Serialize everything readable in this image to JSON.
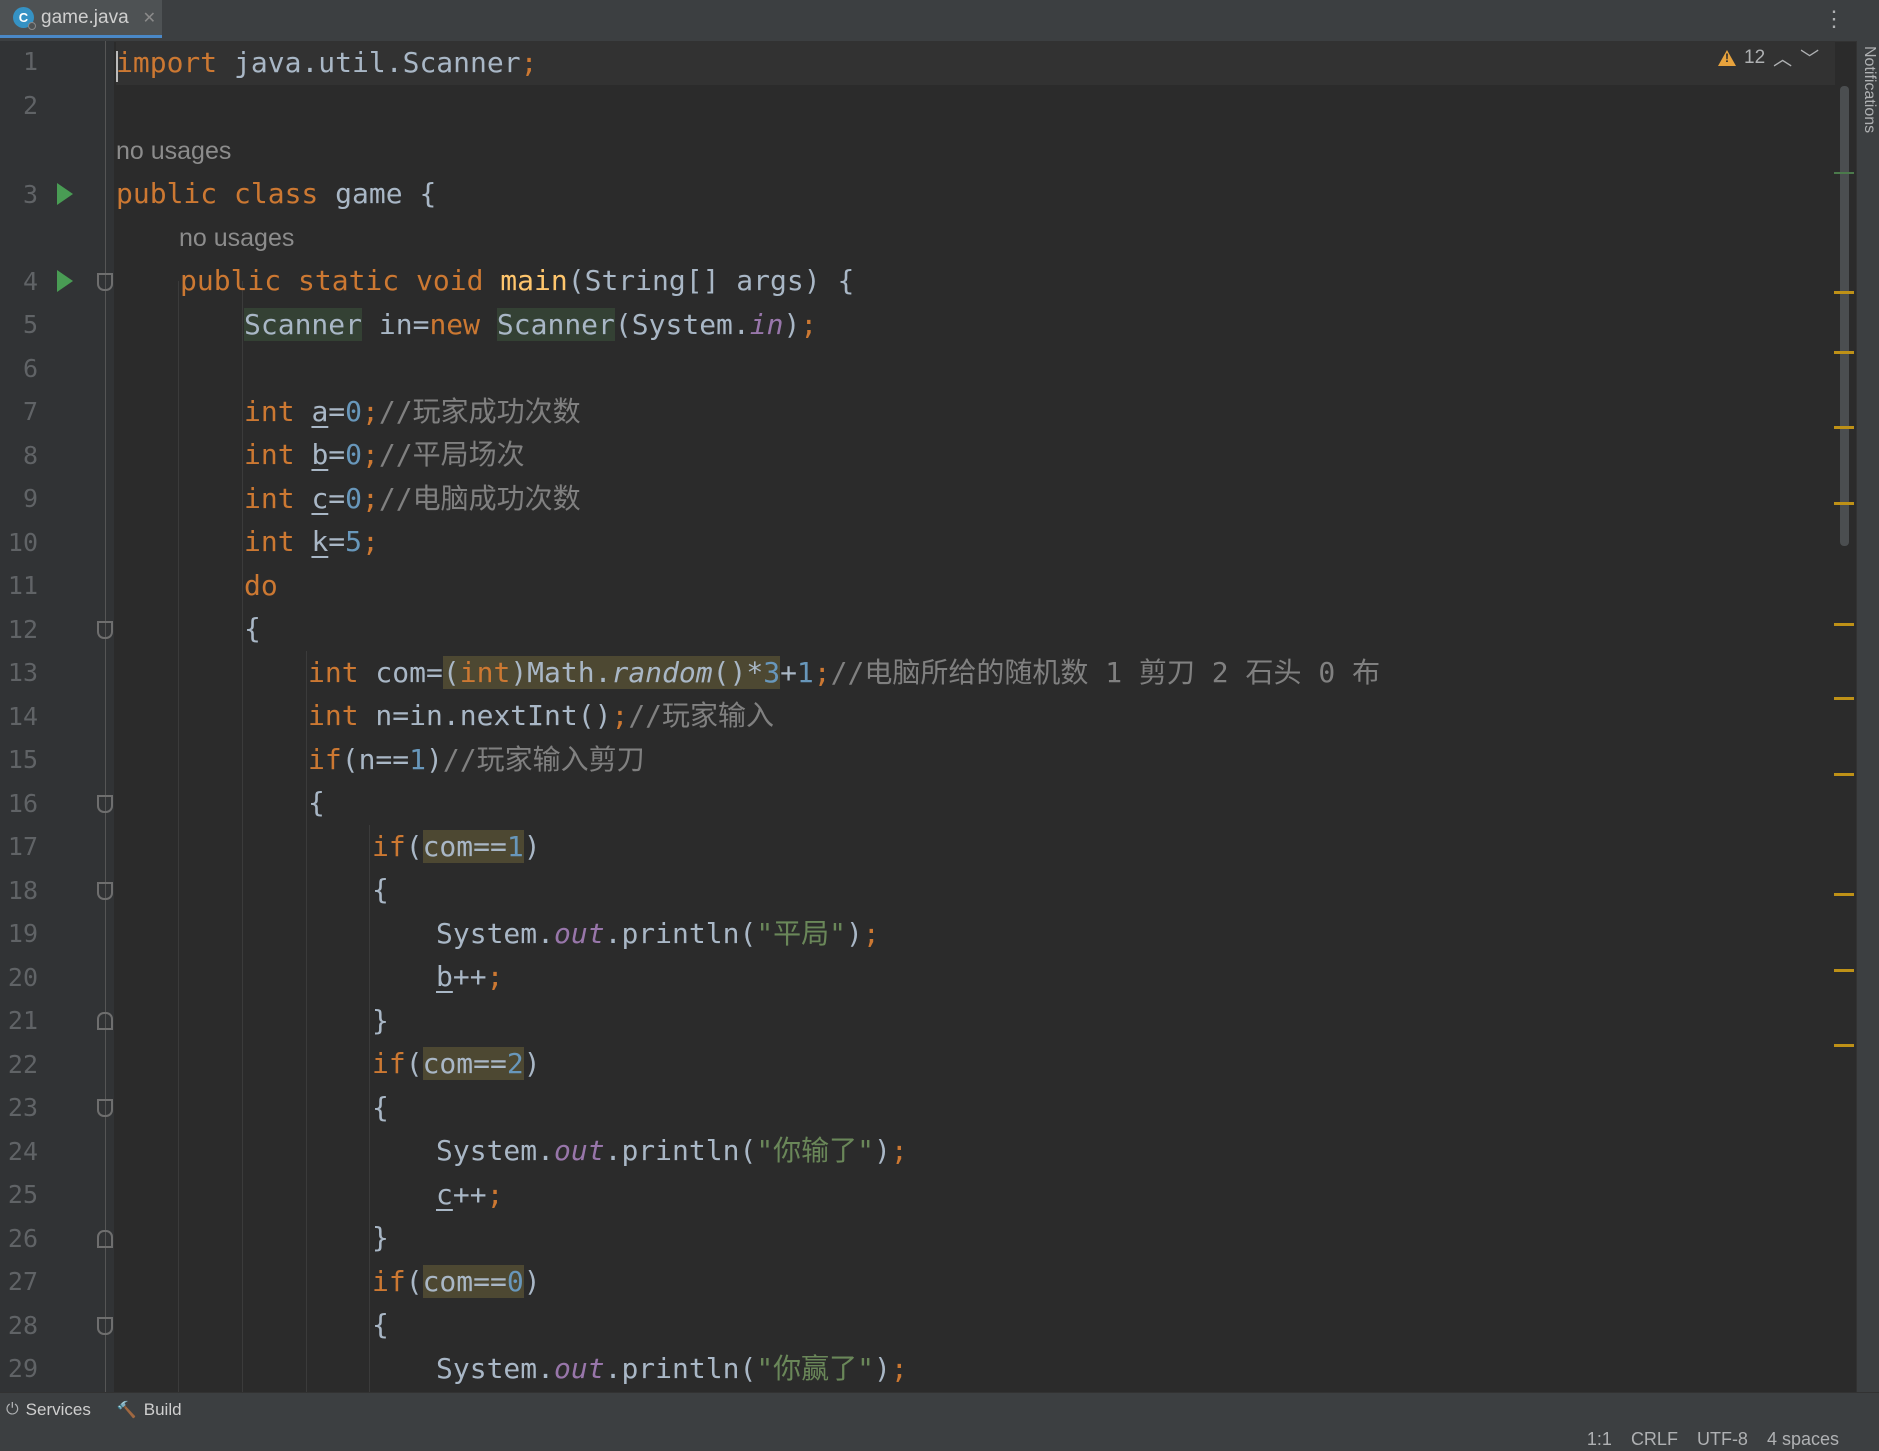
{
  "editor_tab": {
    "file_name": "game.java",
    "close_glyph": "✕",
    "file_icon_letter": "C"
  },
  "tab_menu_glyph": "⋮",
  "notifications_label": "Notifications",
  "inspection": {
    "warning_count": "12",
    "prev_glyph": "︿",
    "next_glyph": "﹀"
  },
  "hints": {
    "class_usage": "no usages",
    "method_usage": "no usages"
  },
  "line_numbers": [
    "1",
    "2",
    "3",
    "4",
    "5",
    "6",
    "7",
    "8",
    "9",
    "10",
    "11",
    "12",
    "13",
    "14",
    "15",
    "16",
    "17",
    "18",
    "19",
    "20",
    "21",
    "22",
    "23",
    "24",
    "25",
    "26",
    "27",
    "28",
    "29"
  ],
  "code": {
    "l1": {
      "kw": "import",
      "rest": " java.util.Scanner",
      "semi": ";"
    },
    "l3": {
      "kw": "public class",
      "rest": " game {"
    },
    "l4": {
      "kw": "public static void",
      "fn": "main",
      "rest": "(String[] args) {"
    },
    "l5": {
      "type1": "Scanner",
      "var": " in=",
      "kw": "new",
      "type2": "Scanner",
      "sys": "(System.",
      "field": "in",
      "end": ")",
      "semi": ";"
    },
    "l7": {
      "kw": "int",
      "var": "a",
      "eq": "=",
      "num": "0",
      "semi": ";",
      "cmt": "//玩家成功次数"
    },
    "l8": {
      "kw": "int",
      "var": "b",
      "eq": "=",
      "num": "0",
      "semi": ";",
      "cmt": "//平局场次"
    },
    "l9": {
      "kw": "int",
      "var": "c",
      "eq": "=",
      "num": "0",
      "semi": ";",
      "cmt": "//电脑成功次数"
    },
    "l10": {
      "kw": "int",
      "var": "k",
      "eq": "=",
      "num": "5",
      "semi": ";"
    },
    "l11": {
      "kw": "do"
    },
    "l12": {
      "brace": "{"
    },
    "l13": {
      "kw": "int",
      "var": " com=",
      "p1": "(",
      "cast": "int",
      "p2": ")Math.",
      "method": "random",
      "p3": "()*",
      "num": "3",
      "plus": "+",
      "num2": "1",
      "semi": ";",
      "cmt": "//电脑所给的随机数 1 剪刀 2 石头 0 布"
    },
    "l14": {
      "kw": "int",
      "var": " n=in.nextInt()",
      "semi": ";",
      "cmt": "//玩家输入"
    },
    "l15": {
      "kw": "if",
      "cond": "(n==",
      "num": "1",
      "close": ")",
      "cmt": "//玩家输入剪刀"
    },
    "l16": {
      "brace": "{"
    },
    "l17": {
      "kw": "if",
      "open": "(",
      "cond": "com==",
      "num": "1",
      "close": ")"
    },
    "l18": {
      "brace": "{"
    },
    "l19": {
      "sys": "System.",
      "field": "out",
      "call": ".println(",
      "str": "\"平局\"",
      "close": ")",
      "semi": ";"
    },
    "l20": {
      "var": "b",
      "op": "++",
      "semi": ";"
    },
    "l21": {
      "brace": "}"
    },
    "l22": {
      "kw": "if",
      "open": "(",
      "cond": "com==",
      "num": "2",
      "close": ")"
    },
    "l23": {
      "brace": "{"
    },
    "l24": {
      "sys": "System.",
      "field": "out",
      "call": ".println(",
      "str": "\"你输了\"",
      "close": ")",
      "semi": ";"
    },
    "l25": {
      "var": "c",
      "op": "++",
      "semi": ";"
    },
    "l26": {
      "brace": "}"
    },
    "l27": {
      "kw": "if",
      "open": "(",
      "cond": "com==",
      "num": "0",
      "close": ")"
    },
    "l28": {
      "brace": "{"
    },
    "l29": {
      "sys": "System.",
      "field": "out",
      "call": ".println(",
      "str": "\"你赢了\"",
      "close": ")",
      "semi": ";"
    }
  },
  "toolbar": {
    "services": "Services",
    "build": "Build",
    "services_icon_glyph": "⏻",
    "build_icon_glyph": "🔨"
  },
  "status": {
    "position": "1:1",
    "line_separator": "CRLF",
    "encoding": "UTF-8",
    "indent": "4 spaces"
  },
  "colors": {
    "keyword": "#cc7832",
    "number": "#6897bb",
    "comment": "#808080",
    "string": "#6a8759",
    "function": "#ffc66d",
    "static_field": "#9876aa",
    "background": "#2b2b2b"
  }
}
